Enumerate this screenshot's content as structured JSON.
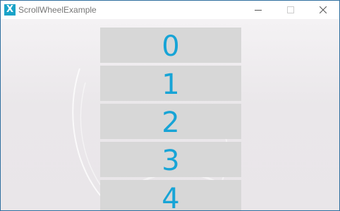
{
  "window": {
    "title": "ScrollWheelExample",
    "app_icon_letter": "X",
    "controls": [
      "minimize-icon",
      "maximize-icon",
      "close-icon"
    ]
  },
  "colors": {
    "item_background": "#d7d7d7",
    "digit_color": "#17a4d6",
    "app_icon": "#1aa3c8"
  },
  "scroll_wheel": {
    "items": [
      "0",
      "1",
      "2",
      "3",
      "4"
    ]
  }
}
